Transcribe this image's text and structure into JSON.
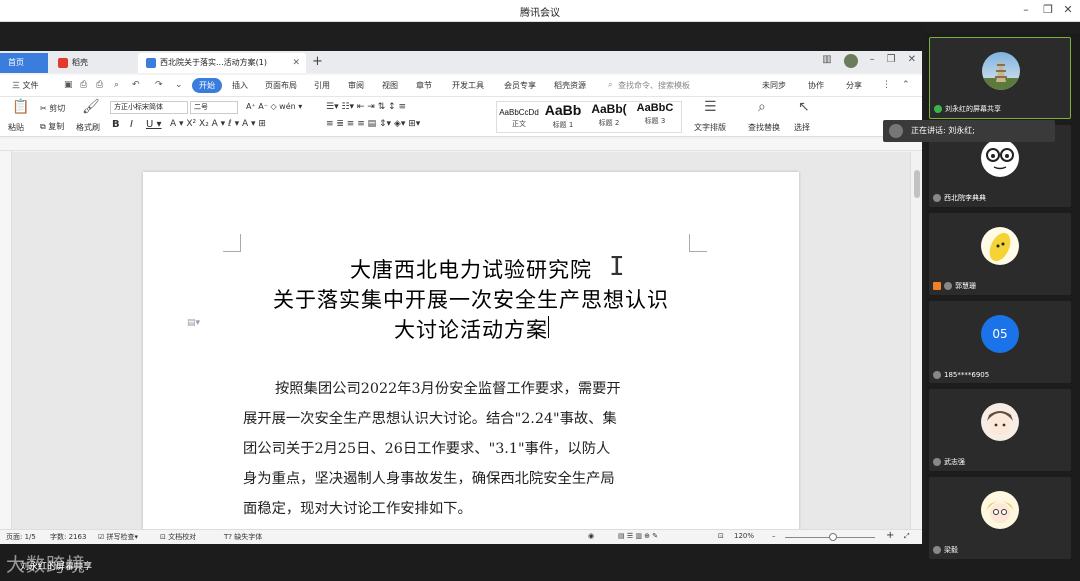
{
  "meeting": {
    "title": "腾讯会议",
    "presenter_label": "刘永红的屏幕共享",
    "watermark": "大数跨境",
    "speaking_label": "正在讲话: 刘永红;"
  },
  "wps": {
    "tabs": [
      {
        "label": "首页"
      },
      {
        "label": "稻壳"
      },
      {
        "label": "西北院关于落实...活动方案(1)"
      }
    ],
    "menu": {
      "file": "三 文件",
      "start": "开始",
      "items": [
        "插入",
        "页面布局",
        "引用",
        "审阅",
        "视图",
        "章节",
        "开发工具",
        "会员专享",
        "稻壳资源"
      ],
      "search_placeholder": "查找命令、搜索模板",
      "sync": "未同步",
      "collab": "协作",
      "share": "分享"
    },
    "ribbon": {
      "paste": "粘贴",
      "cut": "剪切",
      "copy": "复制",
      "format_painter": "格式刷",
      "font_name": "方正小标宋简体",
      "font_size": "二号",
      "styles": [
        {
          "sample": "AaBbCcDd",
          "name": "正文"
        },
        {
          "sample": "AaBb",
          "name": "标题 1"
        },
        {
          "sample": "AaBb(",
          "name": "标题 2"
        },
        {
          "sample": "AaBbC",
          "name": "标题 3"
        }
      ],
      "text_layout": "文字排版",
      "find_replace": "查找替换",
      "select": "选择"
    },
    "document": {
      "title_lines": [
        "大唐西北电力试验研究院",
        "关于落实集中开展一次安全生产思想认识",
        "大讨论活动方案"
      ],
      "para_lines": [
        "按照集团公司2022年3月份安全监督工作要求，需要开",
        "展开展一次安全生产思想认识大讨论。结合\"2.24\"事故、集",
        "团公司关于2月25日、26日工作要求、\"3.1\"事件，以防人",
        "身为重点，坚决遏制人身事故发生，确保西北院安全生产局",
        "面稳定，现对大讨论工作安排如下。"
      ]
    },
    "status": {
      "page": "页面: 1/5",
      "words": "字数: 2163",
      "spell": "拼写检查",
      "doc_check": "文档校对",
      "missing_font": "缺失字体",
      "zoom": "120%"
    }
  },
  "participants": [
    {
      "name": "刘永红的屏幕共享",
      "active": true
    },
    {
      "name": "西北院李典典"
    },
    {
      "name": "郭慧珊"
    },
    {
      "name": "185****6905",
      "initials": "05"
    },
    {
      "name": "武志强"
    },
    {
      "name": "梁毅"
    }
  ],
  "colors": {
    "accent": "#3b7ddd",
    "active_tile_border": "#7bb23a",
    "initials_avatar": "#1a73e8"
  }
}
